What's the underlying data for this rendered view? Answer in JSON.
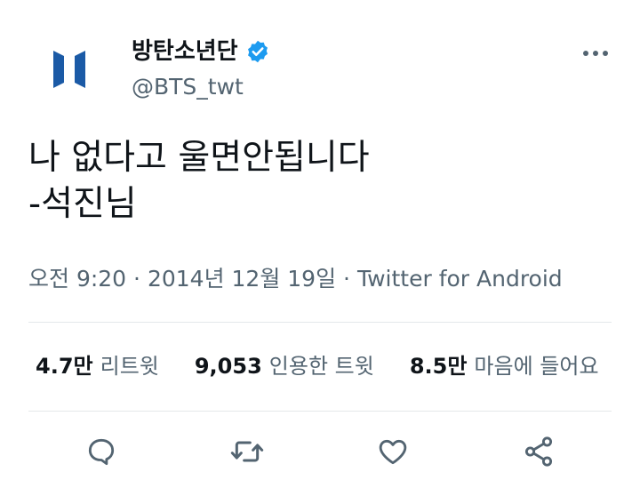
{
  "author": {
    "display_name": "방탄소년단",
    "handle": "@BTS_twt",
    "verified": true,
    "avatar_icon": "bts-logo-icon",
    "brand_color": "#1b5aa6"
  },
  "tweet": {
    "text": "나 없다고 울면안됩니다\n-석진님"
  },
  "meta": {
    "time": "오전 9:20",
    "separator": "·",
    "date": "2014년 12월 19일",
    "source": "Twitter for Android"
  },
  "stats": [
    {
      "value": "4.7만",
      "label": "리트윗"
    },
    {
      "value": "9,053",
      "label": "인용한 트윗"
    },
    {
      "value": "8.5만",
      "label": "마음에 들어요"
    }
  ],
  "actions": [
    {
      "icon": "reply-icon"
    },
    {
      "icon": "retweet-icon"
    },
    {
      "icon": "like-icon"
    },
    {
      "icon": "share-icon"
    }
  ],
  "colors": {
    "text": "#0f1419",
    "secondary": "#536471",
    "verified": "#1d9bf0",
    "divider": "#e4e8ea"
  }
}
